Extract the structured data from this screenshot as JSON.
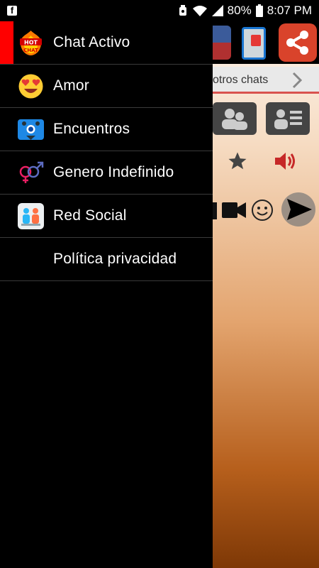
{
  "status_bar": {
    "notification_icon": "facebook-icon",
    "battery_percent": "80%",
    "time": "8:07 PM"
  },
  "drawer": {
    "items": [
      {
        "label": "Chat Activo",
        "icon": "hot-chat-logo-icon",
        "active": true
      },
      {
        "label": "Amor",
        "icon": "heart-eyes-emoji-icon",
        "active": false
      },
      {
        "label": "Encuentros",
        "icon": "map-pin-users-icon",
        "active": false
      },
      {
        "label": "Genero Indefinido",
        "icon": "gender-symbols-icon",
        "active": false
      },
      {
        "label": "Red Social",
        "icon": "social-network-icon",
        "active": false
      },
      {
        "label": "Política privacidad",
        "icon": "",
        "active": false
      }
    ]
  },
  "background_app": {
    "subbar_text": "otros chats"
  },
  "colors": {
    "active_marker": "#ff0000",
    "share_button": "#d9432b",
    "subbar_accent": "#d9534f"
  }
}
